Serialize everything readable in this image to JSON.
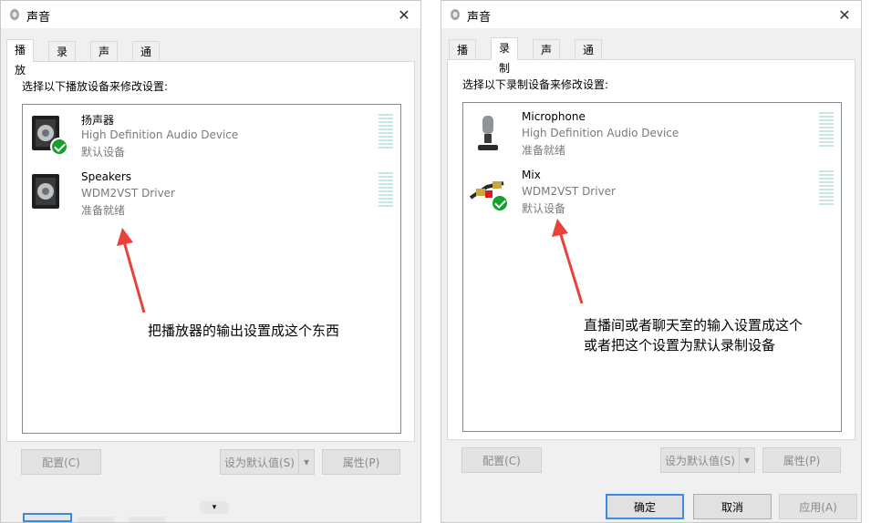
{
  "left_window": {
    "title": "声音",
    "tabs": [
      "播放",
      "录制",
      "声音",
      "通信"
    ],
    "active_tab": "播放",
    "hint": "选择以下播放设备来修改设置:",
    "devices": [
      {
        "name": "扬声器",
        "driver": "High Definition Audio Device",
        "status": "默认设备"
      },
      {
        "name": "Speakers",
        "driver": "WDM2VST Driver",
        "status": "准备就绪"
      }
    ],
    "buttons": {
      "configure": "配置(C)",
      "set_default": "设为默认值(S)",
      "properties": "属性(P)"
    },
    "annotation": "把播放器的输出设置成这个东西"
  },
  "right_window": {
    "title": "声音",
    "tabs": [
      "播放",
      "录制",
      "声音",
      "通信"
    ],
    "active_tab": "录制",
    "hint": "选择以下录制设备来修改设置:",
    "devices": [
      {
        "name": "Microphone",
        "driver": "High Definition Audio Device",
        "status": "准备就绪"
      },
      {
        "name": "Mix",
        "driver": "WDM2VST Driver",
        "status": "默认设备"
      }
    ],
    "buttons": {
      "configure": "配置(C)",
      "set_default": "设为默认值(S)",
      "properties": "属性(P)",
      "ok": "确定",
      "cancel": "取消",
      "apply": "应用(A)"
    },
    "annotation_line1": "直播间或者聊天室的输入设置成这个",
    "annotation_line2": "或者把这个设置为默认录制设备"
  },
  "colors": {
    "accent": "#3c8be0",
    "check": "#13a02c",
    "annotation_arrow": "#e8423a"
  }
}
